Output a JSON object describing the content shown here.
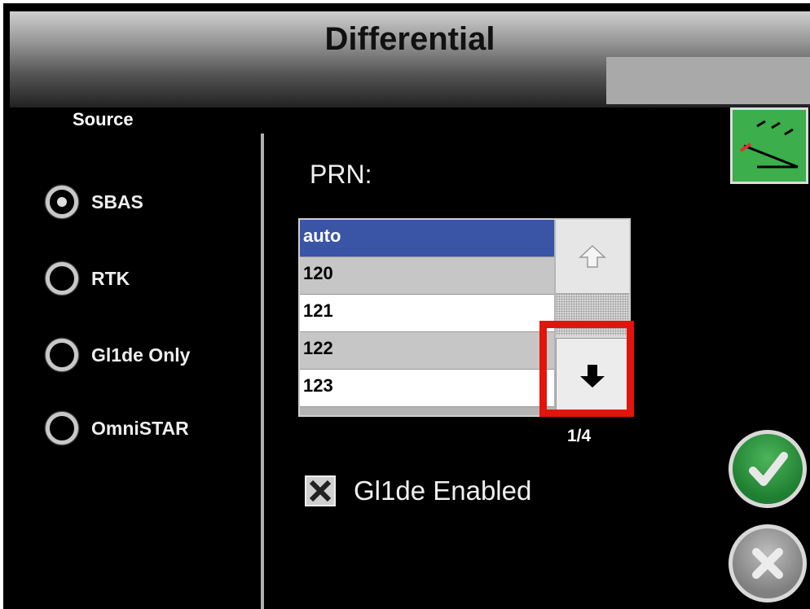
{
  "header": {
    "title": "Differential"
  },
  "source": {
    "label": "Source",
    "options": [
      {
        "label": "SBAS",
        "selected": true
      },
      {
        "label": "RTK",
        "selected": false
      },
      {
        "label": "Gl1de Only",
        "selected": false
      },
      {
        "label": "OmniSTAR",
        "selected": false
      }
    ]
  },
  "prn": {
    "label": "PRN:",
    "items": [
      "auto",
      "120",
      "121",
      "122",
      "123"
    ],
    "selected": "auto",
    "page_indicator": "1/4"
  },
  "glide_enabled": {
    "label": "Gl1de Enabled",
    "checked": true
  },
  "colors": {
    "selection": "#3a55a6",
    "highlight_box": "#e3140c",
    "confirm": "#2f9a3f"
  },
  "icons": {
    "guide": "guidance-lines-icon",
    "confirm": "checkmark-icon",
    "cancel": "close-icon",
    "up": "arrow-up-icon",
    "down": "arrow-down-icon"
  }
}
